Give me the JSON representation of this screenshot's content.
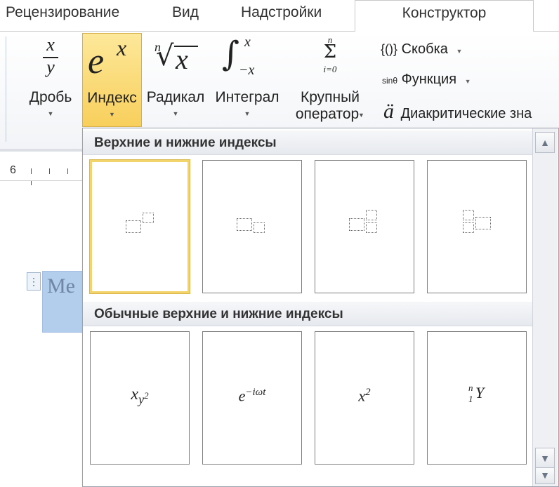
{
  "tabs": {
    "review": "Рецензирование",
    "view": "Вид",
    "addins": "Надстройки",
    "design": "Конструктор"
  },
  "ribbon": {
    "fraction": {
      "label": "Дробь",
      "num": "x",
      "den": "y"
    },
    "script": {
      "label": "Индекс",
      "base": "e",
      "exp": "x"
    },
    "radical": {
      "label": "Радикал",
      "index": "n",
      "radicand": "x",
      "sign": "√"
    },
    "integral": {
      "label": "Интеграл",
      "sign": "∫",
      "upper": "x",
      "lower": "−x"
    },
    "large_operator": {
      "label_line1": "Крупный",
      "label_line2": "оператор",
      "upper": "n",
      "sign": "Σ",
      "lower": "i=0"
    },
    "bracket": {
      "icon_text": "{()}",
      "label": "Скобка"
    },
    "function": {
      "icon_text": "sinθ",
      "label": "Функция"
    },
    "accent": {
      "icon_text": "ä",
      "label": "Диакритические зна"
    },
    "dropdown_arrow": "▼"
  },
  "ruler": {
    "number": "6"
  },
  "document": {
    "equation_text": "Me",
    "handle_icon": "⋮"
  },
  "gallery": {
    "section1_title": "Верхние и нижние индексы",
    "section2_title": "Обычные верхние и нижние индексы",
    "common_items": [
      {
        "base": "x",
        "sub": "y",
        "sub_sup": "2"
      },
      {
        "base": "e",
        "sup": "−iωt"
      },
      {
        "base": "x",
        "sup": "2"
      },
      {
        "presup": "n",
        "presub": "1",
        "base": "Y"
      }
    ]
  },
  "scrollbar": {
    "up": "▲",
    "down": "▼"
  }
}
